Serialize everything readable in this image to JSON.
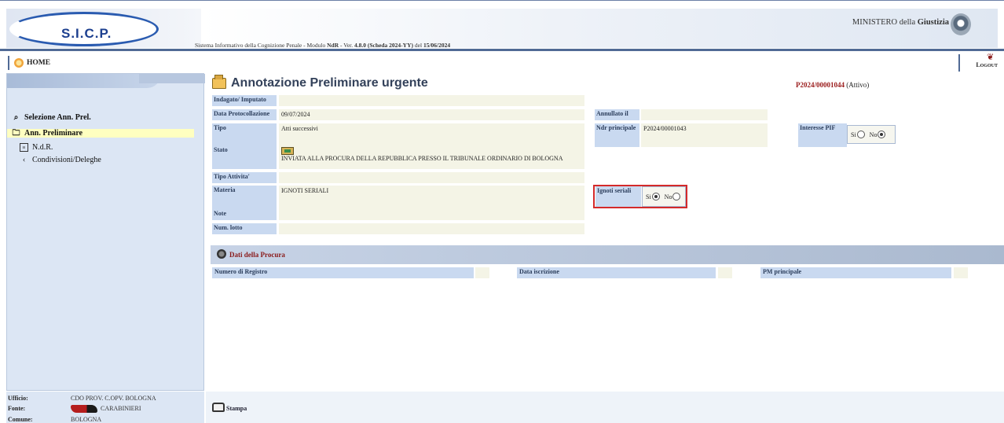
{
  "header": {
    "logo_text": "S.I.C.P.",
    "system_title_parts": {
      "sistema": "S",
      "sistema_rest": "istema ",
      "informativo": "I",
      "informativo_rest": "nformativo della ",
      "cognizione": "C",
      "cognizione_rest": "ognizione ",
      "penale": "P",
      "penale_rest": "enale - Modulo ",
      "module": "NdR",
      "ver_prefix": " - Ver. ",
      "version": "4.8.0 (Scheda 2024-YY)",
      "date_prefix": " del ",
      "date": "15/06/2024"
    },
    "ministry_prefix": "MINISTERO della ",
    "ministry_name": "Giustizia"
  },
  "nav": {
    "home_label": "HOME",
    "logout_label": "Logout"
  },
  "sidebar": {
    "items": [
      {
        "label": "Selezione Ann. Prel.",
        "icon": "search-icon"
      },
      {
        "label": "Ann. Preliminare",
        "icon": "folder-icon"
      },
      {
        "label": "N.d.R.",
        "icon": "document-icon"
      },
      {
        "label": "Condivisioni/Deleghe",
        "icon": "share-icon"
      }
    ],
    "footer": {
      "ufficio_label": "Ufficio:",
      "ufficio_value": "CDO PROV. C.OPV. BOLOGNA",
      "fonte_label": "Fonte:",
      "fonte_value": "CARABINIERI",
      "comune_label": "Comune:",
      "comune_value": "BOLOGNA"
    }
  },
  "main": {
    "title": "Annotazione Preliminare urgente",
    "protocol_number": "P2024/00001044",
    "protocol_status": "(Attivo)",
    "fields": {
      "indagato_label": "Indagato/ Imputato",
      "indagato_value": "",
      "data_prot_label": "Data Protocollazione",
      "data_prot_value": "09/07/2024",
      "annullato_label": "Annullato il",
      "annullato_value": "",
      "tipo_label": "Tipo",
      "tipo_value": "Atti successivi",
      "ndr_label": "Ndr principale",
      "ndr_value": "P2024/00001043",
      "interesse_label": "Interesse PIF",
      "interesse_si": "Si",
      "interesse_no": "No",
      "interesse_selected": "No",
      "stato_label": "Stato",
      "stato_value": "INVIATA ALLA PROCURA DELLA REPUBBLICA PRESSO IL TRIBUNALE ORDINARIO DI BOLOGNA",
      "tipo_attivita_label": "Tipo Attivita'",
      "tipo_attivita_value": "",
      "materia_label": "Materia",
      "materia_value": "IGNOTI SERIALI",
      "ignoti_label": "Ignoti seriali",
      "ignoti_si": "Si",
      "ignoti_no": "No",
      "ignoti_selected": "Si",
      "note_label": "Note",
      "note_value": "",
      "num_lotto_label": "Num. lotto",
      "num_lotto_value": ""
    },
    "procura": {
      "title": "Dati della Procura",
      "numero_registro_label": "Numero di Registro",
      "data_iscrizione_label": "Data iscrizione",
      "pm_principale_label": "PM principale"
    }
  },
  "bottom": {
    "print_label": "Stampa"
  }
}
